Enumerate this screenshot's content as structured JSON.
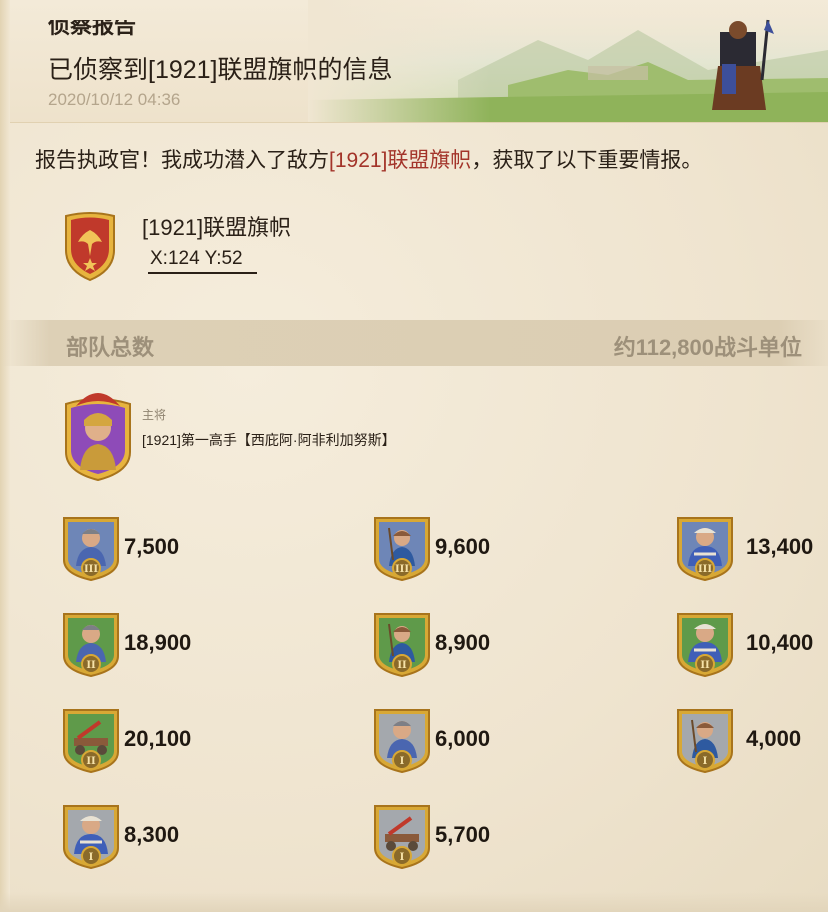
{
  "header": {
    "title_top": "侦察报告",
    "heading": "已侦察到[1921]联盟旗帜的信息",
    "date": "2020/10/12 04:36"
  },
  "message": {
    "prefix": "报告执政官！我成功潜入了敌方",
    "target": "[1921]联盟旗帜",
    "suffix": "，获取了以下重要情报。"
  },
  "alliance": {
    "name": "[1921]联盟旗帜",
    "coords": "X:124 Y:52",
    "crest_icon": "alliance-crest-icon"
  },
  "troops": {
    "label": "部队总数",
    "total": "约112,800战斗单位"
  },
  "commander": {
    "role": "主将",
    "name": "[1921]第一高手【西庇阿·阿非利加努斯】",
    "portrait_icon": "commander-portrait-icon"
  },
  "units": [
    {
      "count": "7,500",
      "icon": "infantry-icon",
      "tier": "III",
      "theme": "blue",
      "accent": "#6e86b7"
    },
    {
      "count": "9,600",
      "icon": "archer-icon",
      "tier": "III",
      "theme": "blue",
      "accent": "#6e86b7"
    },
    {
      "count": "13,400",
      "icon": "cavalry-icon",
      "tier": "III",
      "theme": "blue",
      "accent": "#6e86b7"
    },
    {
      "count": "18,900",
      "icon": "infantry-icon",
      "tier": "II",
      "theme": "green",
      "accent": "#5f9a4a"
    },
    {
      "count": "8,900",
      "icon": "archer-icon",
      "tier": "II",
      "theme": "green",
      "accent": "#5f9a4a"
    },
    {
      "count": "10,400",
      "icon": "cavalry-icon",
      "tier": "II",
      "theme": "green",
      "accent": "#5f9a4a"
    },
    {
      "count": "20,100",
      "icon": "siege-icon",
      "tier": "II",
      "theme": "green",
      "accent": "#5f9a4a"
    },
    {
      "count": "6,000",
      "icon": "infantry-icon",
      "tier": "I",
      "theme": "grey",
      "accent": "#a4a8ad"
    },
    {
      "count": "4,000",
      "icon": "archer-icon",
      "tier": "I",
      "theme": "grey",
      "accent": "#a4a8ad"
    },
    {
      "count": "8,300",
      "icon": "cavalry-icon",
      "tier": "I",
      "theme": "grey",
      "accent": "#a4a8ad"
    },
    {
      "count": "5,700",
      "icon": "siege-icon",
      "tier": "I",
      "theme": "grey",
      "accent": "#a4a8ad"
    }
  ],
  "colors": {
    "highlight": "#a3342a",
    "muted": "#9d907a",
    "date": "#b4a58c",
    "gold": "#d8a835"
  }
}
